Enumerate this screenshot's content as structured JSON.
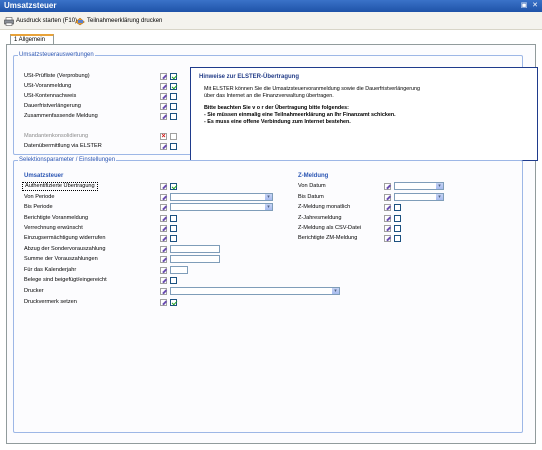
{
  "window": {
    "title": "Umsatzsteuer",
    "controls": [
      "▣",
      "✕"
    ]
  },
  "toolbar": {
    "print_label": "Ausdruck starten (F10)",
    "participation_label": "Teilnahmeerklärung drucken"
  },
  "tabs": [
    {
      "label": "1 Allgemein",
      "active": true
    }
  ],
  "evaluations": {
    "legend": "Umsatzsteuerauswertungen",
    "items": [
      {
        "label": "USt-Prüfliste (Verprobung)",
        "checked": true,
        "enabled": true
      },
      {
        "label": "USt-Voranmeldung",
        "checked": true,
        "enabled": true
      },
      {
        "label": "USt-Kontennachweis",
        "checked": false,
        "enabled": true
      },
      {
        "label": "Dauerfristverlängerung",
        "checked": false,
        "enabled": true
      },
      {
        "label": "Zusammenfassende Meldung",
        "checked": false,
        "enabled": true
      },
      {
        "label": "Mandantenkonsolidierung",
        "checked": false,
        "enabled": false
      },
      {
        "label": "Datenübermittlung via ELSTER",
        "checked": false,
        "enabled": true
      }
    ]
  },
  "info": {
    "title": "Hinweise zur ELSTER-Übertragung",
    "line1": "Mit ELSTER können Sie die Umsatzsteuervoranmeldung sowie die Dauerfristverlängerung",
    "line2": "über das Internet an die Finanzverwaltung übertragen.",
    "line3": "Bitte beachten Sie  v o r  der Übertragung bitte folgendes:",
    "line4": "- Sie müssen einmalig eine Teilnahmeerklärung an Ihr Finanzamt schicken.",
    "line5": "- Es muss eine offene Verbindung zum Internet bestehen."
  },
  "selection": {
    "legend": "Selektionsparameter / Einstellungen",
    "ust_heading": "Umsatzsteuer",
    "ust_rows": [
      {
        "label": "Authentifizierte Übertragung",
        "control": "checkbox",
        "checked": true,
        "focused": true
      },
      {
        "label": "Von Periode",
        "control": "select",
        "value": ""
      },
      {
        "label": "Bis Periode",
        "control": "select",
        "value": ""
      },
      {
        "label": "Berichtigte Voranmeldung",
        "control": "checkbox",
        "checked": false
      },
      {
        "label": "Verrechnung erwünscht",
        "control": "checkbox",
        "checked": false
      },
      {
        "label": "Einzugsermächtigung widerrufen",
        "control": "checkbox",
        "checked": false
      },
      {
        "label": "Abzug der Sondervorauszahlung",
        "control": "input",
        "value": ""
      },
      {
        "label": "Summe der Vorauszahlungen",
        "control": "input",
        "value": ""
      },
      {
        "label": "Für das Kalenderjahr",
        "control": "input-short",
        "value": ""
      },
      {
        "label": "Belege sind beigefügt/eingereicht",
        "control": "checkbox",
        "checked": false
      },
      {
        "label": "Drucker",
        "control": "select-wide",
        "value": ""
      },
      {
        "label": "Druckvermerk setzen",
        "control": "checkbox",
        "checked": true
      }
    ],
    "zm_heading": "Z-Meldung",
    "zm_rows": [
      {
        "label": "Von Datum",
        "control": "date",
        "value": ""
      },
      {
        "label": "Bis Datum",
        "control": "date",
        "value": ""
      },
      {
        "label": "Z-Meldung monatlich",
        "control": "checkbox",
        "checked": false
      },
      {
        "label": "Z-Jahresmeldung",
        "control": "checkbox",
        "checked": false
      },
      {
        "label": "Z-Meldung als CSV-Datei",
        "control": "checkbox",
        "checked": false
      },
      {
        "label": "Berichtigte ZM-Meldung",
        "control": "checkbox",
        "checked": false
      }
    ]
  }
}
